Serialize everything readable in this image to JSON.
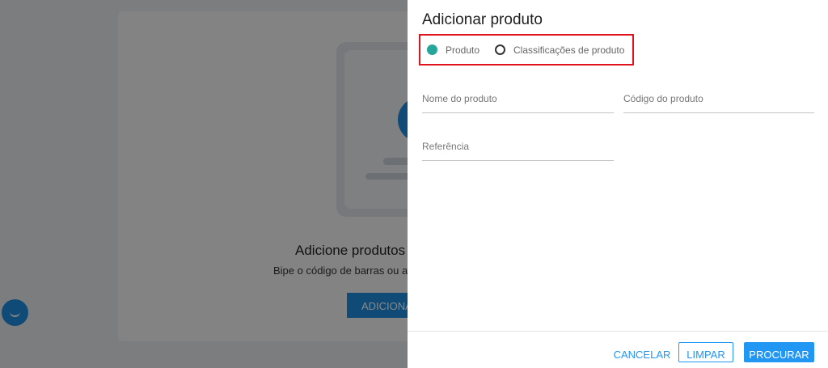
{
  "background": {
    "heading": "Adicione produtos pa",
    "subtext": "Bipe o código de barras ou adic",
    "button_label": "ADICIONA"
  },
  "dialog": {
    "title": "Adicionar produto",
    "search_mode": {
      "options": [
        "Produto",
        "Classificações de produto"
      ],
      "selected": "Produto"
    },
    "fields": {
      "nome_placeholder": "Nome do produto",
      "codigo_placeholder": "Código do produto",
      "referencia_placeholder": "Referência"
    },
    "footer": {
      "cancel_label": "CANCELAR",
      "clear_label": "LIMPAR",
      "search_label": "PROCURAR"
    }
  },
  "colors": {
    "accent": "#2196f3",
    "radio_selected": "#26a69a",
    "highlight_border": "#e0141f"
  }
}
